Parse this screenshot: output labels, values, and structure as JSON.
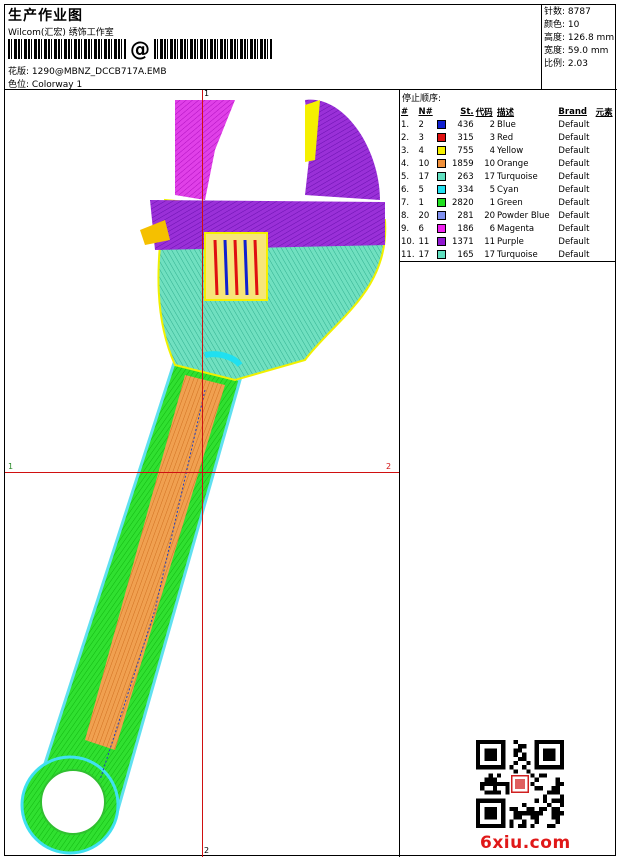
{
  "header": {
    "title": "生产作业图",
    "company": "Wilcom(汇宏) 绣饰工作室",
    "barcode_text": "@",
    "design_label": "花版:",
    "design_value": "1290@MBNZ_DCCB717A.EMB",
    "colorway_label": "色位:",
    "colorway_value": "Colorway 1"
  },
  "stats": [
    {
      "label": "针数:",
      "value": "8787"
    },
    {
      "label": "颜色:",
      "value": "10"
    },
    {
      "label": "高度:",
      "value": "126.8 mm"
    },
    {
      "label": "宽度:",
      "value": "59.0 mm"
    },
    {
      "label": "比例:",
      "value": "2.03"
    }
  ],
  "markers": {
    "top": "1",
    "left": "1",
    "right": "2",
    "bottom": "2"
  },
  "stop_sequence": {
    "title": "停止顺序:",
    "columns": [
      "#",
      "N#",
      "",
      "St.",
      "代码",
      "描述",
      "Brand",
      "元素"
    ],
    "rows": [
      {
        "idx": "1.",
        "n": "2",
        "color": "#1020d0",
        "st": "436",
        "code": "2",
        "desc": "Blue",
        "brand": "Default"
      },
      {
        "idx": "2.",
        "n": "3",
        "color": "#e01010",
        "st": "315",
        "code": "3",
        "desc": "Red",
        "brand": "Default"
      },
      {
        "idx": "3.",
        "n": "4",
        "color": "#f5f000",
        "st": "755",
        "code": "4",
        "desc": "Yellow",
        "brand": "Default"
      },
      {
        "idx": "4.",
        "n": "10",
        "color": "#f0903a",
        "st": "1859",
        "code": "10",
        "desc": "Orange",
        "brand": "Default"
      },
      {
        "idx": "5.",
        "n": "17",
        "color": "#60e0c0",
        "st": "263",
        "code": "17",
        "desc": "Turquoise",
        "brand": "Default"
      },
      {
        "idx": "6.",
        "n": "5",
        "color": "#20e0f0",
        "st": "334",
        "code": "5",
        "desc": "Cyan",
        "brand": "Default"
      },
      {
        "idx": "7.",
        "n": "1",
        "color": "#20e020",
        "st": "2820",
        "code": "1",
        "desc": "Green",
        "brand": "Default"
      },
      {
        "idx": "8.",
        "n": "20",
        "color": "#8090f0",
        "st": "281",
        "code": "20",
        "desc": "Powder Blue",
        "brand": "Default"
      },
      {
        "idx": "9.",
        "n": "6",
        "color": "#f020f0",
        "st": "186",
        "code": "6",
        "desc": "Magenta",
        "brand": "Default"
      },
      {
        "idx": "10.",
        "n": "11",
        "color": "#9018d0",
        "st": "1371",
        "code": "11",
        "desc": "Purple",
        "brand": "Default"
      },
      {
        "idx": "11.",
        "n": "17",
        "color": "#60e0c0",
        "st": "165",
        "code": "17",
        "desc": "Turquoise",
        "brand": "Default"
      }
    ]
  },
  "watermark": "6xiu.com"
}
